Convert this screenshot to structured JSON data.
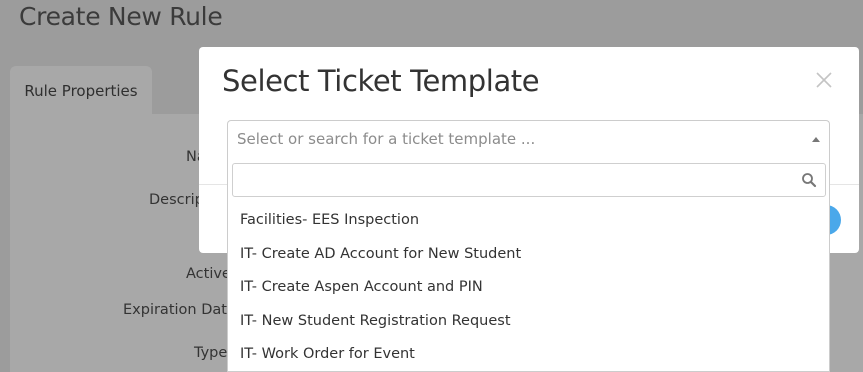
{
  "page": {
    "title": "Create New Rule",
    "tab_label": "Rule Properties",
    "labels": {
      "name": "Na",
      "description": "Descrip",
      "active": "Active",
      "expiration_date": "Expiration Date",
      "type": "Type"
    }
  },
  "modal": {
    "title": "Select Ticket Template",
    "close_icon": "close-icon",
    "select": {
      "placeholder": "Select or search for a ticket template ...",
      "search_value": "",
      "options": [
        "Facilities- EES Inspection",
        "IT- Create AD Account for New Student",
        "IT- Create Aspen Account and PIN",
        "IT- New Student Registration Request",
        "IT- Work Order for Event"
      ]
    }
  },
  "colors": {
    "overlay": "#9c9c9c",
    "primary": "#4aa8ea"
  }
}
